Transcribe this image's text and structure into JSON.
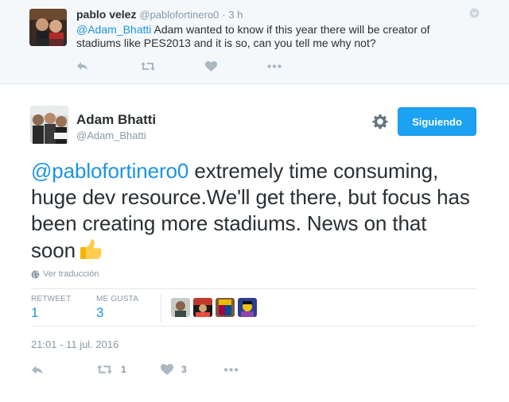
{
  "parent_tweet": {
    "fullname": "pablo velez",
    "screenname": "@pablofortinero0",
    "separator": "·",
    "time": "3 h",
    "mention": "@Adam_Bhatti",
    "text": " Adam wanted to know if this year there will be creator of stadiums like PES2013 and it is so, can you tell me why not?",
    "actions": [
      "reply-icon",
      "retweet-icon",
      "like-icon",
      "more-icon"
    ]
  },
  "main_tweet": {
    "fullname": "Adam Bhatti",
    "screenname": "@Adam_Bhatti",
    "follow_label": "Siguiendo",
    "mention": "@pablofortinero0",
    "text": " extremely time consuming, huge dev resource.We'll get there, but focus has been creating more stadiums. News on that soon",
    "emoji": "thumbs-up-emoji",
    "translate_label": "Ver traducción",
    "stats": {
      "retweet_label": "RETWEET",
      "retweet_count": "1",
      "likes_label": "ME GUSTA",
      "likes_count": "3"
    },
    "timestamp": "21:01 - 11 jul. 2016",
    "actions": {
      "retweet_count": "1",
      "like_count": "3"
    }
  },
  "colors": {
    "accent": "#1da1f2",
    "link": "#1b95e0",
    "muted": "#8899a6",
    "text": "#292f33",
    "parent_bg": "#f5f8fa"
  }
}
